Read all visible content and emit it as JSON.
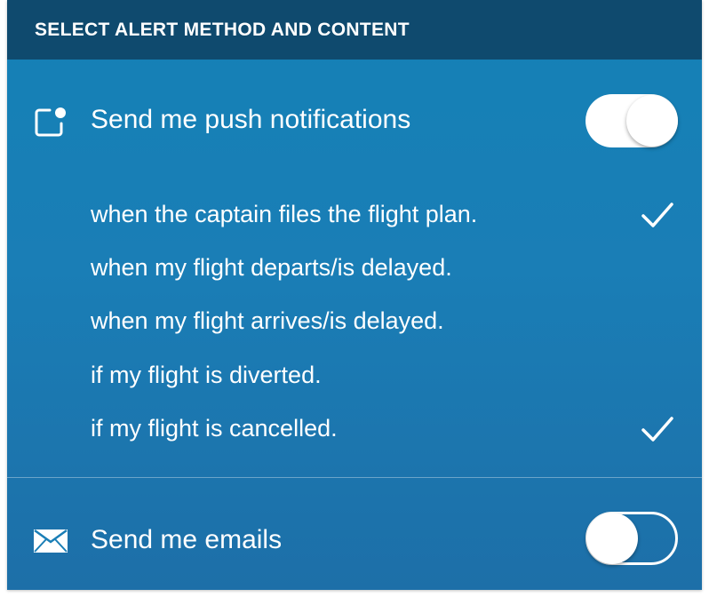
{
  "header": {
    "title": "SELECT ALERT METHOD AND CONTENT"
  },
  "push": {
    "icon": "push-notification-icon",
    "label": "Send me push notifications",
    "enabled": true
  },
  "options": [
    {
      "label": "when the captain files the flight plan.",
      "checked": true
    },
    {
      "label": "when my flight departs/is delayed.",
      "checked": false
    },
    {
      "label": "when my flight arrives/is delayed.",
      "checked": false
    },
    {
      "label": "if my flight is diverted.",
      "checked": false
    },
    {
      "label": "if my flight is cancelled.",
      "checked": true
    }
  ],
  "email": {
    "icon": "envelope-icon",
    "label": "Send me emails",
    "enabled": false
  },
  "colors": {
    "header_bg": "#0f4a6e",
    "panel_bg": "#1a7eb6",
    "text": "#ffffff"
  }
}
